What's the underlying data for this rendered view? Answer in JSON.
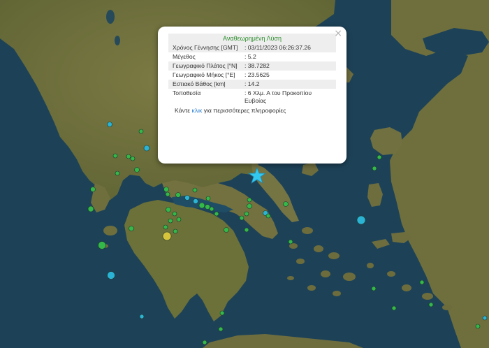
{
  "popup": {
    "title": "Αναθεωρημένη Λύση",
    "close_glyph": "×",
    "rows": [
      {
        "label": "Χρόνος Γέννησης [GMT]",
        "value": ": 03/11/2023 06:26:37.26"
      },
      {
        "label": "Μέγεθος",
        "value": ": 5.2"
      },
      {
        "label": "Γεωγραφικό Πλάτος [°N]",
        "value": ": 38.7282"
      },
      {
        "label": "Γεωγραφικό Μήκος [°E]",
        "value": ": 23.5625"
      },
      {
        "label": "Εστιακό Βάθος [km]",
        "value": ": 14.2"
      },
      {
        "label": "Τοποθεσία",
        "value": ": 6 Χλμ. Α του Προκοπίου Ευβοίας"
      }
    ],
    "more_before": "Κάντε ",
    "more_link": "κλικ",
    "more_after": " για περισσότερες πληροφορίες"
  },
  "colors": {
    "sea": "#1d4258",
    "land": "#74733f",
    "highland": "#5e6b3a",
    "quake_green": "#34b84a",
    "quake_cyan": "#2bb3d6",
    "quake_yellow": "#d8c43c",
    "main_star": "#33c8f0"
  },
  "main_event_icon": "star-icon"
}
